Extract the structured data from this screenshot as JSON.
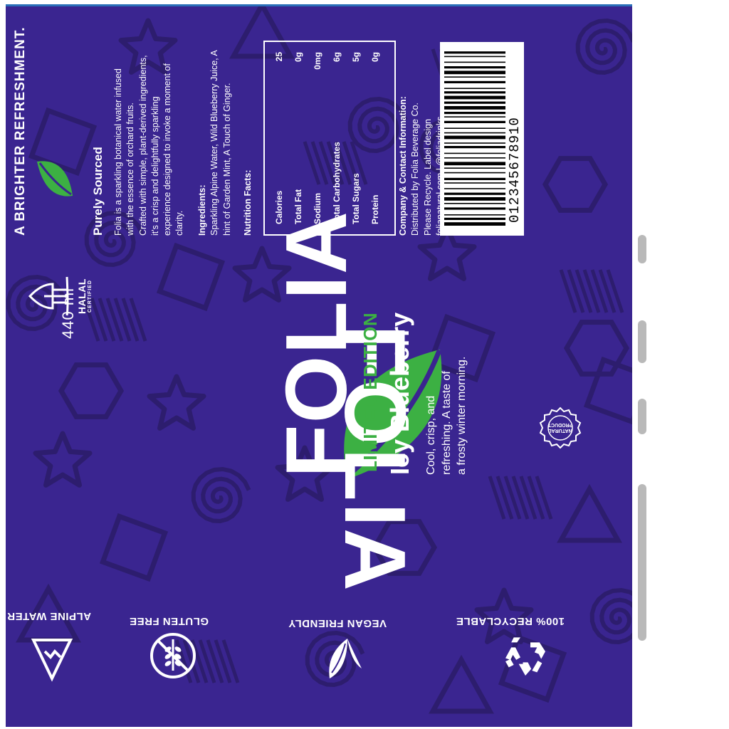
{
  "brand": {
    "name": "FOLIA",
    "edition": "LIMITED EDITION",
    "flavor": "Icy Blueberry",
    "description_lines": [
      "Cool, crisp, and",
      "refreshing. A taste of",
      "a frosty winter morning."
    ]
  },
  "volume": "440 ml",
  "tagline": "A BRIGHTER REFRESHMENT.",
  "subhead": "Purely Sourced",
  "product_text_lines": [
    "Folia is a sparkling botanical water infused",
    "with the essence of orchard fruits.",
    "Crafted with simple, plant-derived ingredients,",
    "it's a crisp and delightfully sparkling",
    "experience designed to invoke a moment of",
    "clarity."
  ],
  "ingredients": {
    "heading": "Ingredients:",
    "lines": [
      "Sparkling Alpine Water, Wild Blueberry Juice, A",
      "hint of Garden Mint, A Touch of Ginger."
    ]
  },
  "nutrition": {
    "heading": "Nutrition Facts:",
    "rows": [
      {
        "label": "Calories",
        "value": "25"
      },
      {
        "label": "Total Fat",
        "value": "0g"
      },
      {
        "label": "Sodium",
        "value": "0mg"
      },
      {
        "label": "Total Carbohydrates",
        "value": "6g"
      },
      {
        "label": "Total Sugars",
        "value": "5g"
      },
      {
        "label": "Protein",
        "value": "0g"
      }
    ]
  },
  "company": {
    "heading": "Company & Contact Information:",
    "lines": [
      "Distributed by Folia Beverage Co.",
      "Please Recycle. Label design",
      "folianatural.com | @foliadrinks"
    ]
  },
  "barcode": {
    "digits": "012345678910"
  },
  "badges": {
    "alpine": "ALPINE WATER",
    "gluten": "GLUTEN FREE",
    "vegan": "VEGAN FRIENDLY",
    "recyclable": "100% RECYCLABLE"
  },
  "halal": {
    "title": "HALAL",
    "subtitle": "CERTIFIED"
  },
  "seal": {
    "text": "NATURAL PRODUCT"
  },
  "colors": {
    "background": "#3a2590",
    "pattern": "#2d1d6e",
    "accent_green": "#3cb043",
    "text": "#ffffff"
  },
  "icons": [
    "leaf-logo",
    "small-leaf-icon",
    "recycle-icon",
    "vegan-leaf-icon",
    "gluten-free-wheat-icon",
    "alpine-mountain-icon",
    "halal-mosque-icon",
    "natural-seal-icon",
    "barcode"
  ]
}
